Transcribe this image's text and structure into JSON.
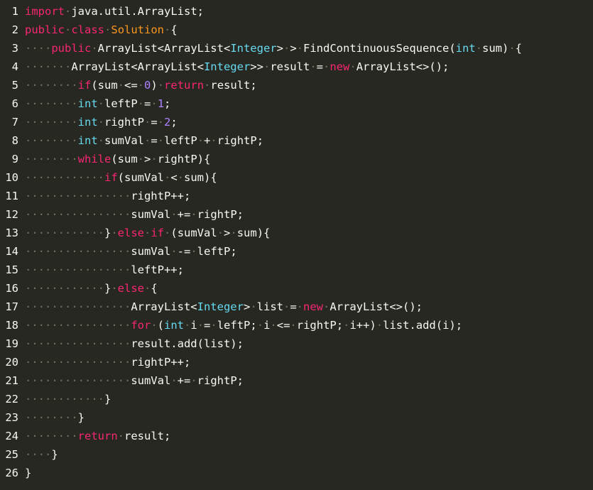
{
  "editor": {
    "colors": {
      "background": "#272822",
      "text": "#f8f8f2",
      "keyword": "#f92672",
      "type": "#66d9ef",
      "class_name": "#fd971f",
      "number": "#ae81ff",
      "whitespace_dot": "#75715e"
    },
    "lines": [
      {
        "number": "1",
        "tokens": [
          {
            "t": "kw",
            "v": "import"
          },
          {
            "t": "ws",
            "v": "·"
          },
          {
            "t": "tx",
            "v": "java.util.ArrayList;"
          }
        ]
      },
      {
        "number": "2",
        "tokens": [
          {
            "t": "kw",
            "v": "public"
          },
          {
            "t": "ws",
            "v": "·"
          },
          {
            "t": "kw",
            "v": "class"
          },
          {
            "t": "ws",
            "v": "·"
          },
          {
            "t": "cl",
            "v": "Solution"
          },
          {
            "t": "ws",
            "v": "·"
          },
          {
            "t": "tx",
            "v": "{"
          }
        ]
      },
      {
        "number": "3",
        "tokens": [
          {
            "t": "ws",
            "v": "····"
          },
          {
            "t": "kw",
            "v": "public"
          },
          {
            "t": "ws",
            "v": "·"
          },
          {
            "t": "tx",
            "v": "ArrayList<ArrayList<"
          },
          {
            "t": "ty",
            "v": "Integer"
          },
          {
            "t": "tx",
            "v": ">"
          },
          {
            "t": "ws",
            "v": "·"
          },
          {
            "t": "tx",
            "v": ">"
          },
          {
            "t": "ws",
            "v": "·"
          },
          {
            "t": "tx",
            "v": "FindContinuousSequence("
          },
          {
            "t": "ty",
            "v": "int"
          },
          {
            "t": "ws",
            "v": "·"
          },
          {
            "t": "tx",
            "v": "sum)"
          },
          {
            "t": "ws",
            "v": "·"
          },
          {
            "t": "tx",
            "v": "{"
          }
        ]
      },
      {
        "number": "4",
        "tokens": [
          {
            "t": "ws",
            "v": "·······"
          },
          {
            "t": "tx",
            "v": "ArrayList<ArrayList<"
          },
          {
            "t": "ty",
            "v": "Integer"
          },
          {
            "t": "tx",
            "v": ">>"
          },
          {
            "t": "ws",
            "v": "·"
          },
          {
            "t": "tx",
            "v": "result"
          },
          {
            "t": "ws",
            "v": "·"
          },
          {
            "t": "tx",
            "v": "="
          },
          {
            "t": "ws",
            "v": "·"
          },
          {
            "t": "kw",
            "v": "new"
          },
          {
            "t": "ws",
            "v": "·"
          },
          {
            "t": "tx",
            "v": "ArrayList<>();"
          }
        ]
      },
      {
        "number": "5",
        "tokens": [
          {
            "t": "ws",
            "v": "········"
          },
          {
            "t": "kw",
            "v": "if"
          },
          {
            "t": "tx",
            "v": "(sum"
          },
          {
            "t": "ws",
            "v": "·"
          },
          {
            "t": "tx",
            "v": "<="
          },
          {
            "t": "ws",
            "v": "·"
          },
          {
            "t": "num",
            "v": "0"
          },
          {
            "t": "tx",
            "v": ")"
          },
          {
            "t": "ws",
            "v": "·"
          },
          {
            "t": "kw",
            "v": "return"
          },
          {
            "t": "ws",
            "v": "·"
          },
          {
            "t": "tx",
            "v": "result;"
          }
        ]
      },
      {
        "number": "6",
        "tokens": [
          {
            "t": "ws",
            "v": "········"
          },
          {
            "t": "ty",
            "v": "int"
          },
          {
            "t": "ws",
            "v": "·"
          },
          {
            "t": "tx",
            "v": "leftP"
          },
          {
            "t": "ws",
            "v": "·"
          },
          {
            "t": "tx",
            "v": "="
          },
          {
            "t": "ws",
            "v": "·"
          },
          {
            "t": "num",
            "v": "1"
          },
          {
            "t": "tx",
            "v": ";"
          }
        ]
      },
      {
        "number": "7",
        "tokens": [
          {
            "t": "ws",
            "v": "········"
          },
          {
            "t": "ty",
            "v": "int"
          },
          {
            "t": "ws",
            "v": "·"
          },
          {
            "t": "tx",
            "v": "rightP"
          },
          {
            "t": "ws",
            "v": "·"
          },
          {
            "t": "tx",
            "v": "="
          },
          {
            "t": "ws",
            "v": "·"
          },
          {
            "t": "num",
            "v": "2"
          },
          {
            "t": "tx",
            "v": ";"
          }
        ]
      },
      {
        "number": "8",
        "tokens": [
          {
            "t": "ws",
            "v": "········"
          },
          {
            "t": "ty",
            "v": "int"
          },
          {
            "t": "ws",
            "v": "·"
          },
          {
            "t": "tx",
            "v": "sumVal"
          },
          {
            "t": "ws",
            "v": "·"
          },
          {
            "t": "tx",
            "v": "="
          },
          {
            "t": "ws",
            "v": "·"
          },
          {
            "t": "tx",
            "v": "leftP"
          },
          {
            "t": "ws",
            "v": "·"
          },
          {
            "t": "tx",
            "v": "+"
          },
          {
            "t": "ws",
            "v": "·"
          },
          {
            "t": "tx",
            "v": "rightP;"
          }
        ]
      },
      {
        "number": "9",
        "tokens": [
          {
            "t": "ws",
            "v": "········"
          },
          {
            "t": "kw",
            "v": "while"
          },
          {
            "t": "tx",
            "v": "(sum"
          },
          {
            "t": "ws",
            "v": "·"
          },
          {
            "t": "tx",
            "v": ">"
          },
          {
            "t": "ws",
            "v": "·"
          },
          {
            "t": "tx",
            "v": "rightP){"
          }
        ]
      },
      {
        "number": "10",
        "tokens": [
          {
            "t": "ws",
            "v": "············"
          },
          {
            "t": "kw",
            "v": "if"
          },
          {
            "t": "tx",
            "v": "(sumVal"
          },
          {
            "t": "ws",
            "v": "·"
          },
          {
            "t": "tx",
            "v": "<"
          },
          {
            "t": "ws",
            "v": "·"
          },
          {
            "t": "tx",
            "v": "sum){"
          }
        ]
      },
      {
        "number": "11",
        "tokens": [
          {
            "t": "ws",
            "v": "················"
          },
          {
            "t": "tx",
            "v": "rightP++;"
          }
        ]
      },
      {
        "number": "12",
        "tokens": [
          {
            "t": "ws",
            "v": "················"
          },
          {
            "t": "tx",
            "v": "sumVal"
          },
          {
            "t": "ws",
            "v": "·"
          },
          {
            "t": "tx",
            "v": "+="
          },
          {
            "t": "ws",
            "v": "·"
          },
          {
            "t": "tx",
            "v": "rightP;"
          }
        ]
      },
      {
        "number": "13",
        "tokens": [
          {
            "t": "ws",
            "v": "············"
          },
          {
            "t": "tx",
            "v": "}"
          },
          {
            "t": "ws",
            "v": "·"
          },
          {
            "t": "kw",
            "v": "else"
          },
          {
            "t": "ws",
            "v": "·"
          },
          {
            "t": "kw",
            "v": "if"
          },
          {
            "t": "ws",
            "v": "·"
          },
          {
            "t": "tx",
            "v": "(sumVal"
          },
          {
            "t": "ws",
            "v": "·"
          },
          {
            "t": "tx",
            "v": ">"
          },
          {
            "t": "ws",
            "v": "·"
          },
          {
            "t": "tx",
            "v": "sum){"
          }
        ]
      },
      {
        "number": "14",
        "tokens": [
          {
            "t": "ws",
            "v": "················"
          },
          {
            "t": "tx",
            "v": "sumVal"
          },
          {
            "t": "ws",
            "v": "·"
          },
          {
            "t": "tx",
            "v": "-="
          },
          {
            "t": "ws",
            "v": "·"
          },
          {
            "t": "tx",
            "v": "leftP;"
          }
        ]
      },
      {
        "number": "15",
        "tokens": [
          {
            "t": "ws",
            "v": "················"
          },
          {
            "t": "tx",
            "v": "leftP++;"
          }
        ]
      },
      {
        "number": "16",
        "tokens": [
          {
            "t": "ws",
            "v": "············"
          },
          {
            "t": "tx",
            "v": "}"
          },
          {
            "t": "ws",
            "v": "·"
          },
          {
            "t": "kw",
            "v": "else"
          },
          {
            "t": "ws",
            "v": "·"
          },
          {
            "t": "tx",
            "v": "{"
          }
        ]
      },
      {
        "number": "17",
        "tokens": [
          {
            "t": "ws",
            "v": "················"
          },
          {
            "t": "tx",
            "v": "ArrayList<"
          },
          {
            "t": "ty",
            "v": "Integer"
          },
          {
            "t": "tx",
            "v": ">"
          },
          {
            "t": "ws",
            "v": "·"
          },
          {
            "t": "tx",
            "v": "list"
          },
          {
            "t": "ws",
            "v": "·"
          },
          {
            "t": "tx",
            "v": "="
          },
          {
            "t": "ws",
            "v": "·"
          },
          {
            "t": "kw",
            "v": "new"
          },
          {
            "t": "ws",
            "v": "·"
          },
          {
            "t": "tx",
            "v": "ArrayList<>();"
          }
        ]
      },
      {
        "number": "18",
        "tokens": [
          {
            "t": "ws",
            "v": "················"
          },
          {
            "t": "kw",
            "v": "for"
          },
          {
            "t": "ws",
            "v": "·"
          },
          {
            "t": "tx",
            "v": "("
          },
          {
            "t": "ty",
            "v": "int"
          },
          {
            "t": "ws",
            "v": "·"
          },
          {
            "t": "tx",
            "v": "i"
          },
          {
            "t": "ws",
            "v": "·"
          },
          {
            "t": "tx",
            "v": "="
          },
          {
            "t": "ws",
            "v": "·"
          },
          {
            "t": "tx",
            "v": "leftP;"
          },
          {
            "t": "ws",
            "v": "·"
          },
          {
            "t": "tx",
            "v": "i"
          },
          {
            "t": "ws",
            "v": "·"
          },
          {
            "t": "tx",
            "v": "<="
          },
          {
            "t": "ws",
            "v": "·"
          },
          {
            "t": "tx",
            "v": "rightP;"
          },
          {
            "t": "ws",
            "v": "·"
          },
          {
            "t": "tx",
            "v": "i++)"
          },
          {
            "t": "ws",
            "v": "·"
          },
          {
            "t": "tx",
            "v": "list.add(i);"
          }
        ]
      },
      {
        "number": "19",
        "tokens": [
          {
            "t": "ws",
            "v": "················"
          },
          {
            "t": "tx",
            "v": "result.add(list);"
          }
        ]
      },
      {
        "number": "20",
        "tokens": [
          {
            "t": "ws",
            "v": "················"
          },
          {
            "t": "tx",
            "v": "rightP++;"
          }
        ]
      },
      {
        "number": "21",
        "tokens": [
          {
            "t": "ws",
            "v": "················"
          },
          {
            "t": "tx",
            "v": "sumVal"
          },
          {
            "t": "ws",
            "v": "·"
          },
          {
            "t": "tx",
            "v": "+="
          },
          {
            "t": "ws",
            "v": "·"
          },
          {
            "t": "tx",
            "v": "rightP;"
          }
        ]
      },
      {
        "number": "22",
        "tokens": [
          {
            "t": "ws",
            "v": "············"
          },
          {
            "t": "tx",
            "v": "}"
          }
        ]
      },
      {
        "number": "23",
        "tokens": [
          {
            "t": "ws",
            "v": "········"
          },
          {
            "t": "tx",
            "v": "}"
          }
        ]
      },
      {
        "number": "24",
        "tokens": [
          {
            "t": "ws",
            "v": "········"
          },
          {
            "t": "kw",
            "v": "return"
          },
          {
            "t": "ws",
            "v": "·"
          },
          {
            "t": "tx",
            "v": "result;"
          }
        ]
      },
      {
        "number": "25",
        "tokens": [
          {
            "t": "ws",
            "v": "····"
          },
          {
            "t": "tx",
            "v": "}"
          }
        ]
      },
      {
        "number": "26",
        "tokens": [
          {
            "t": "tx",
            "v": "}"
          }
        ]
      }
    ]
  }
}
